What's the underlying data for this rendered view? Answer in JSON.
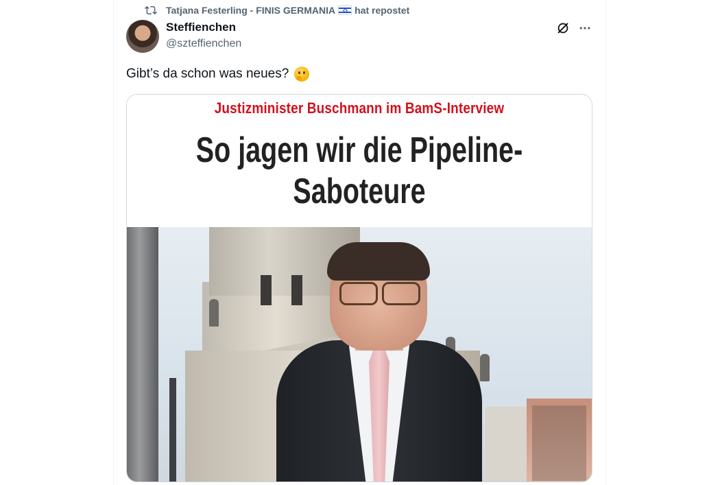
{
  "repost": {
    "text": "Tatjana Festerling - FINIS GERMANIA",
    "suffix": "hat repostet",
    "icon": "repost-icon",
    "flag": "israel-flag-icon"
  },
  "author": {
    "name": "Steffienchen",
    "handle": "@szteffienchen"
  },
  "actions": {
    "grok_icon": "grok-icon",
    "more_icon": "more-icon"
  },
  "tweet": {
    "text": "Gibt’s da schon was neues?",
    "emoji": "thinking-face-emoji"
  },
  "media": {
    "kicker": "Justizminister Buschmann im BamS-Interview",
    "headline_line1": "So jagen wir die Pipeline-",
    "headline_line2": "Saboteure",
    "kicker_color": "#d2101d"
  },
  "colors": {
    "text_primary": "#0f1419",
    "text_secondary": "#536471",
    "border": "#cfd9de"
  }
}
